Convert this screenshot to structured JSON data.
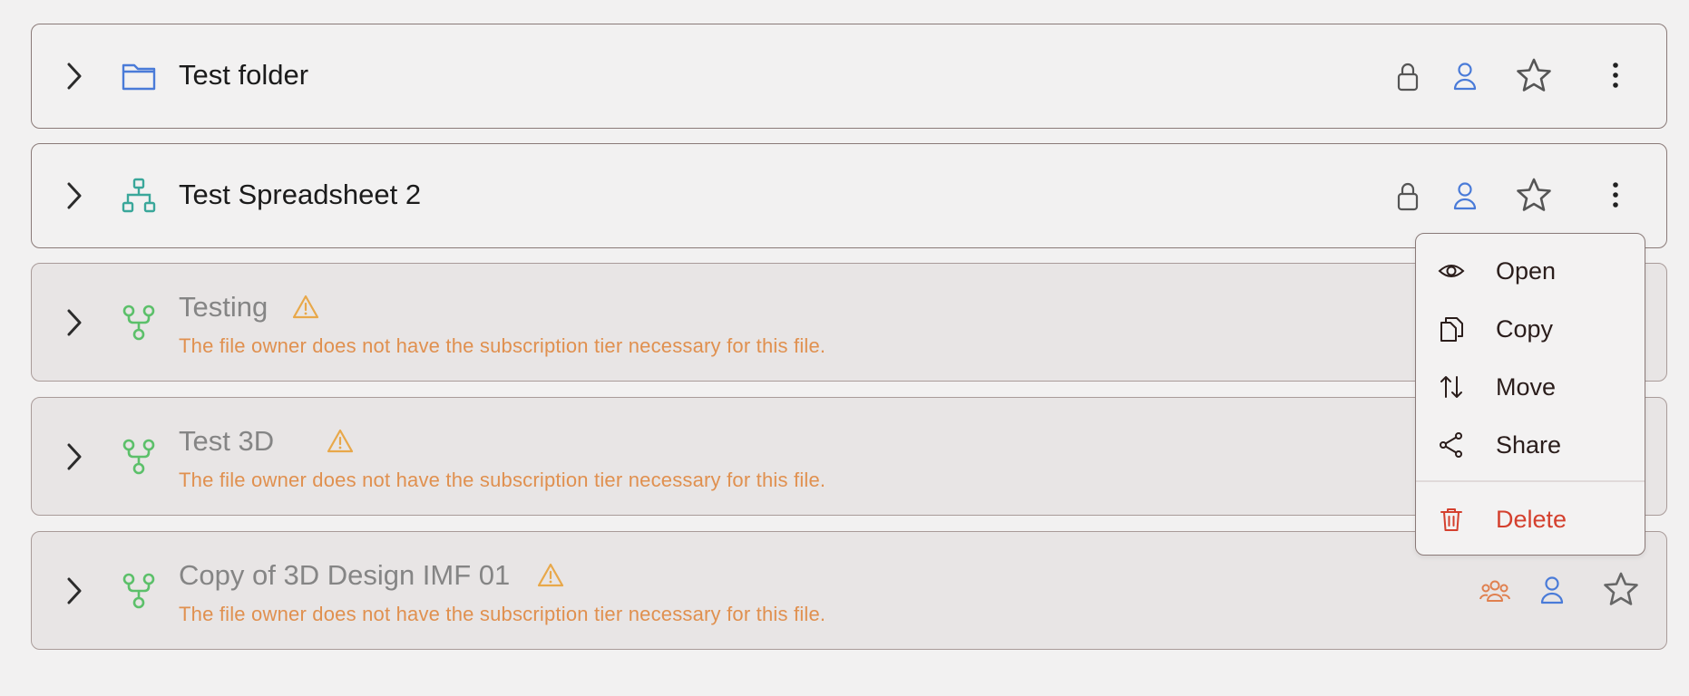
{
  "rows": [
    {
      "title": "Test folder",
      "kind": "folder"
    },
    {
      "title": "Test Spreadsheet 2",
      "kind": "spreadsheet"
    },
    {
      "title": "Testing",
      "kind": "design",
      "warning": "The file owner does not have the subscription tier necessary for this file."
    },
    {
      "title": "Test 3D",
      "kind": "design",
      "warning": "The file owner does not have the subscription tier necessary for this file."
    },
    {
      "title": "Copy of 3D Design IMF 01",
      "kind": "design",
      "warning": "The file owner does not have the subscription tier necessary for this file."
    }
  ],
  "context_menu": {
    "items": [
      {
        "label": "Open",
        "icon": "eye-icon"
      },
      {
        "label": "Copy",
        "icon": "copy-icon"
      },
      {
        "label": "Move",
        "icon": "move-arrows-icon"
      },
      {
        "label": "Share",
        "icon": "share-icon"
      }
    ],
    "delete": {
      "label": "Delete",
      "icon": "trash-icon"
    }
  },
  "colors": {
    "accent_blue": "#4a7bd8",
    "warning_orange": "#e0904f",
    "delete_red": "#d4402e",
    "design_green": "#5cc06a",
    "spreadsheet_teal": "#3aa79a"
  }
}
